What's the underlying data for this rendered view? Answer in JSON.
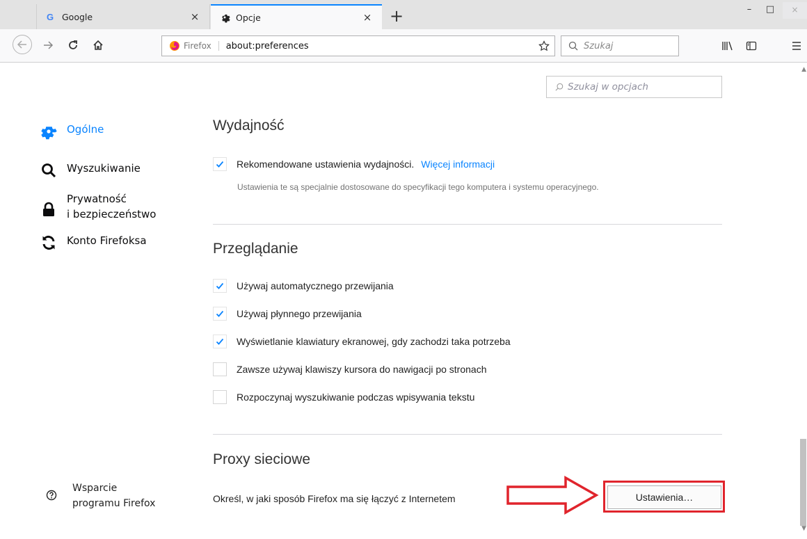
{
  "tabs": [
    {
      "title": "Google",
      "favicon": "google-g-icon",
      "close": "×"
    },
    {
      "title": "Opcje",
      "favicon": "gear-icon",
      "close": "×"
    }
  ],
  "newtab_label": "+",
  "window_controls": {
    "minimize": "–",
    "maximize": "□",
    "close": "×"
  },
  "urlbar": {
    "identity": "Firefox",
    "url": "about:preferences"
  },
  "searchbar": {
    "placeholder": "Szukaj"
  },
  "pref_search": {
    "placeholder": "Szukaj w opcjach"
  },
  "categories": [
    {
      "label": "Ogólne",
      "icon": "gear-icon",
      "selected": true
    },
    {
      "label": "Wyszukiwanie",
      "icon": "search-icon"
    },
    {
      "label_line1": "Prywatność",
      "label_line2": "i bezpieczeństwo",
      "icon": "lock-icon"
    },
    {
      "label": "Konto Firefoksa",
      "icon": "sync-icon"
    }
  ],
  "support": {
    "line1": "Wsparcie",
    "line2": "programu Firefox",
    "icon": "help-icon"
  },
  "performance": {
    "title": "Wydajność",
    "checkbox_label": "Rekomendowane ustawienia wydajności.",
    "link": "Więcej informacji",
    "description": "Ustawienia te są specjalnie dostosowane do specyfikacji tego komputera i systemu operacyjnego.",
    "checked": true
  },
  "browsing": {
    "title": "Przeglądanie",
    "options": [
      {
        "label": "Używaj automatycznego przewijania",
        "checked": true
      },
      {
        "label": "Używaj płynnego przewijania",
        "checked": true
      },
      {
        "label": "Wyświetlanie klawiatury ekranowej, gdy zachodzi taka potrzeba",
        "checked": true
      },
      {
        "label": "Zawsze używaj klawiszy kursora do nawigacji po stronach",
        "checked": false
      },
      {
        "label": "Rozpoczynaj wyszukiwanie podczas wpisywania tekstu",
        "checked": false
      }
    ]
  },
  "proxy": {
    "title": "Proxy sieciowe",
    "description": "Określ, w jaki sposób Firefox ma się łączyć z Internetem",
    "button": "Ustawienia…"
  },
  "colors": {
    "accent": "#0a84ff",
    "annotation": "#e0242c"
  }
}
